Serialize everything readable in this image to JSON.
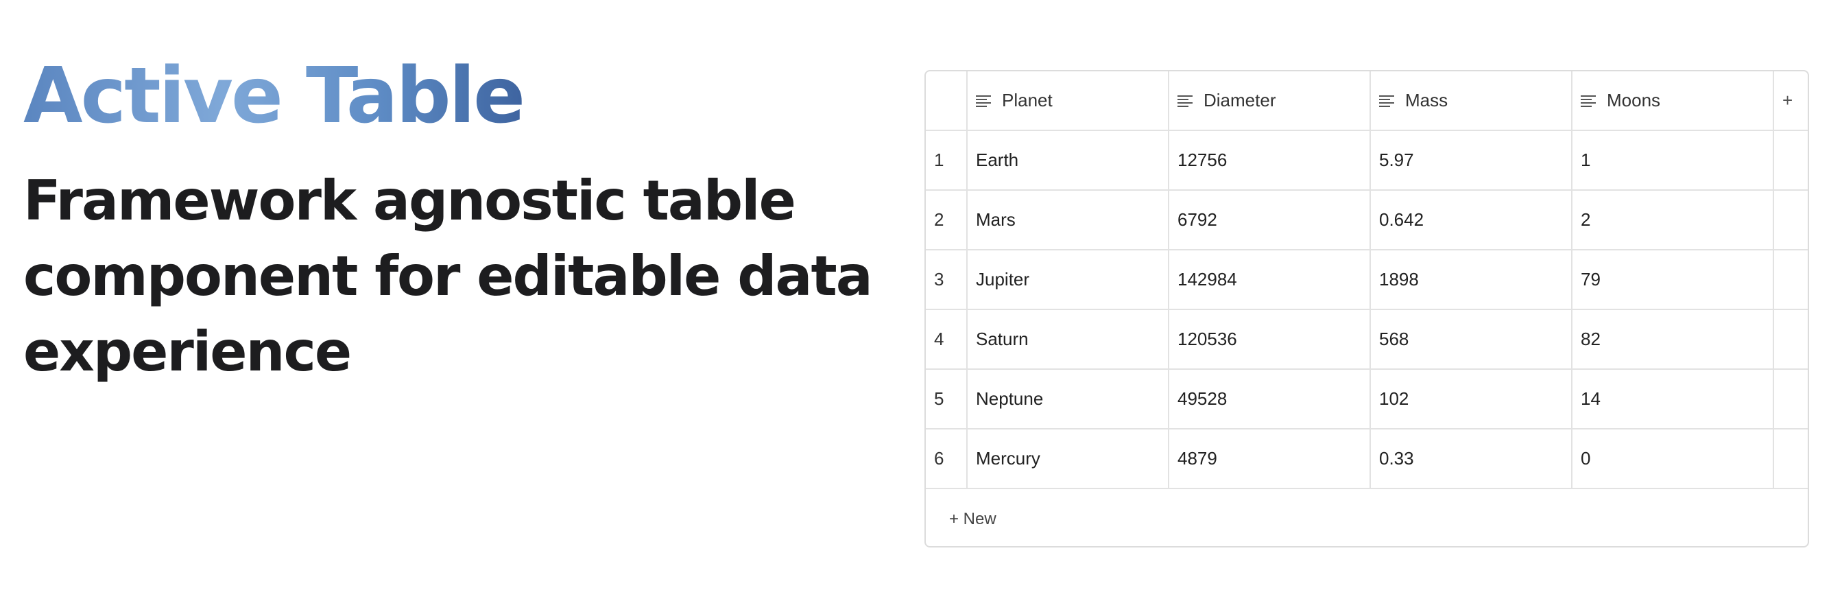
{
  "hero": {
    "title": "Active Table",
    "subtitle": "Framework agnostic table component for editable data experience",
    "title_gradient": [
      "#5b86c0",
      "#7fa8d8",
      "#5f8dc6",
      "#3e64a0"
    ],
    "subtitle_color": "#1d1d1f"
  },
  "table": {
    "columns": [
      {
        "label": "Planet",
        "icon": "text-lines-icon"
      },
      {
        "label": "Diameter",
        "icon": "text-lines-icon"
      },
      {
        "label": "Mass",
        "icon": "text-lines-icon"
      },
      {
        "label": "Moons",
        "icon": "text-lines-icon"
      }
    ],
    "add_column_label": "+",
    "rows": [
      {
        "index": "1",
        "cells": [
          "Earth",
          "12756",
          "5.97",
          "1"
        ]
      },
      {
        "index": "2",
        "cells": [
          "Mars",
          "6792",
          "0.642",
          "2"
        ]
      },
      {
        "index": "3",
        "cells": [
          "Jupiter",
          "142984",
          "1898",
          "79"
        ]
      },
      {
        "index": "4",
        "cells": [
          "Saturn",
          "120536",
          "568",
          "82"
        ]
      },
      {
        "index": "5",
        "cells": [
          "Neptune",
          "49528",
          "102",
          "14"
        ]
      },
      {
        "index": "6",
        "cells": [
          "Mercury",
          "4879",
          "0.33",
          "0"
        ]
      }
    ],
    "new_row_label": "+ New",
    "border_color": "#e2e2e2"
  }
}
